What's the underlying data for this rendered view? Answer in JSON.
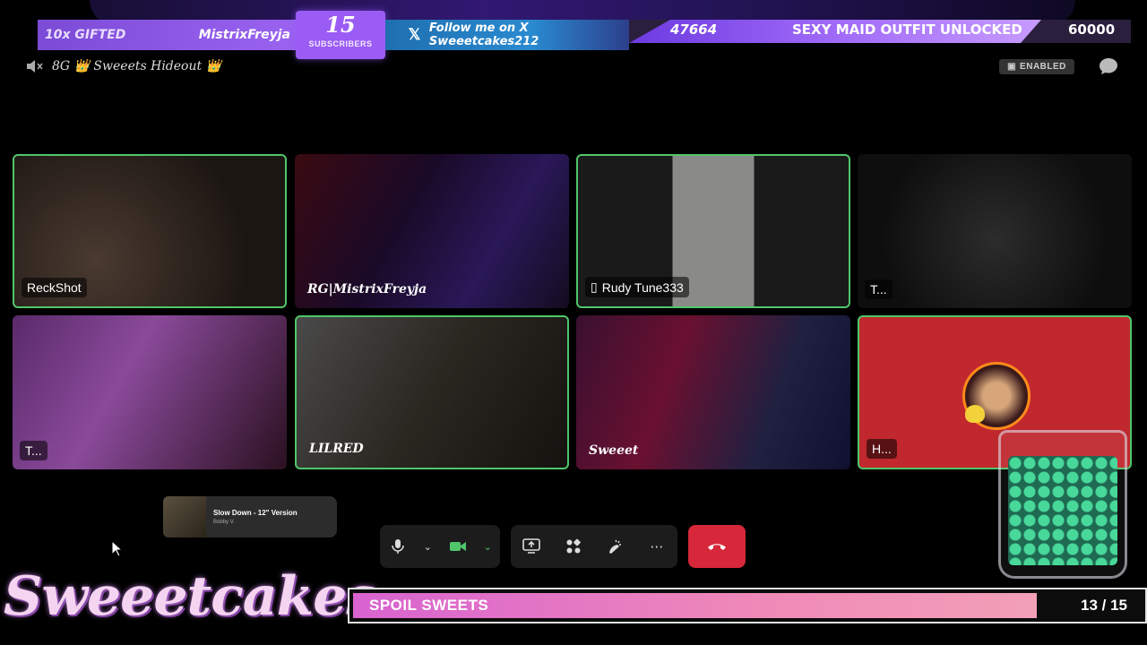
{
  "banner": {
    "gifted_count": "10x GIFTED",
    "gifted_name": "MistrixFreyja",
    "subscribers_count": "15",
    "subscribers_label": "SUBSCRIBERS",
    "follow_text": "Follow me on X Sweeetcakes212",
    "goal_current": "47664",
    "goal_text": "SEXY MAID OUTFIT UNLOCKED",
    "goal_max": "60000",
    "goal_progress": 0.7944
  },
  "call": {
    "room_prefix": "8G",
    "room_name": "👑 Sweeets Hideout 👑",
    "enabled_label": "ENABLED"
  },
  "tiles": [
    {
      "name": "ReckShot",
      "active": true
    },
    {
      "name": "RG|MistrixFreyja",
      "active": false
    },
    {
      "name": "Rudy Tune333",
      "active": true
    },
    {
      "name": "T...",
      "active": false
    },
    {
      "name": "T...",
      "active": false
    },
    {
      "name": "LILRED",
      "active": true
    },
    {
      "name": "Sweeet",
      "active": false
    },
    {
      "name": "H...",
      "active": true
    }
  ],
  "mini_player": {
    "title": "Slow Down - 12\" Version",
    "artist": "Bobby V."
  },
  "controls": {
    "mic": "mic-icon",
    "camera": "camera-icon",
    "share": "screen-share-icon",
    "apps": "apps-icon",
    "effects": "effects-icon",
    "more": "more-icon",
    "hangup": "hangup-icon"
  },
  "footer": {
    "brand": "Sweeetcakes",
    "spoil_label": "SPOIL SWEETS",
    "spoil_count": "13 / 15",
    "spoil_progress": 0.8667
  },
  "colors": {
    "active_border": "#4fc66a",
    "hangup": "#d6283a",
    "accent_purple": "#9b5cf5"
  }
}
